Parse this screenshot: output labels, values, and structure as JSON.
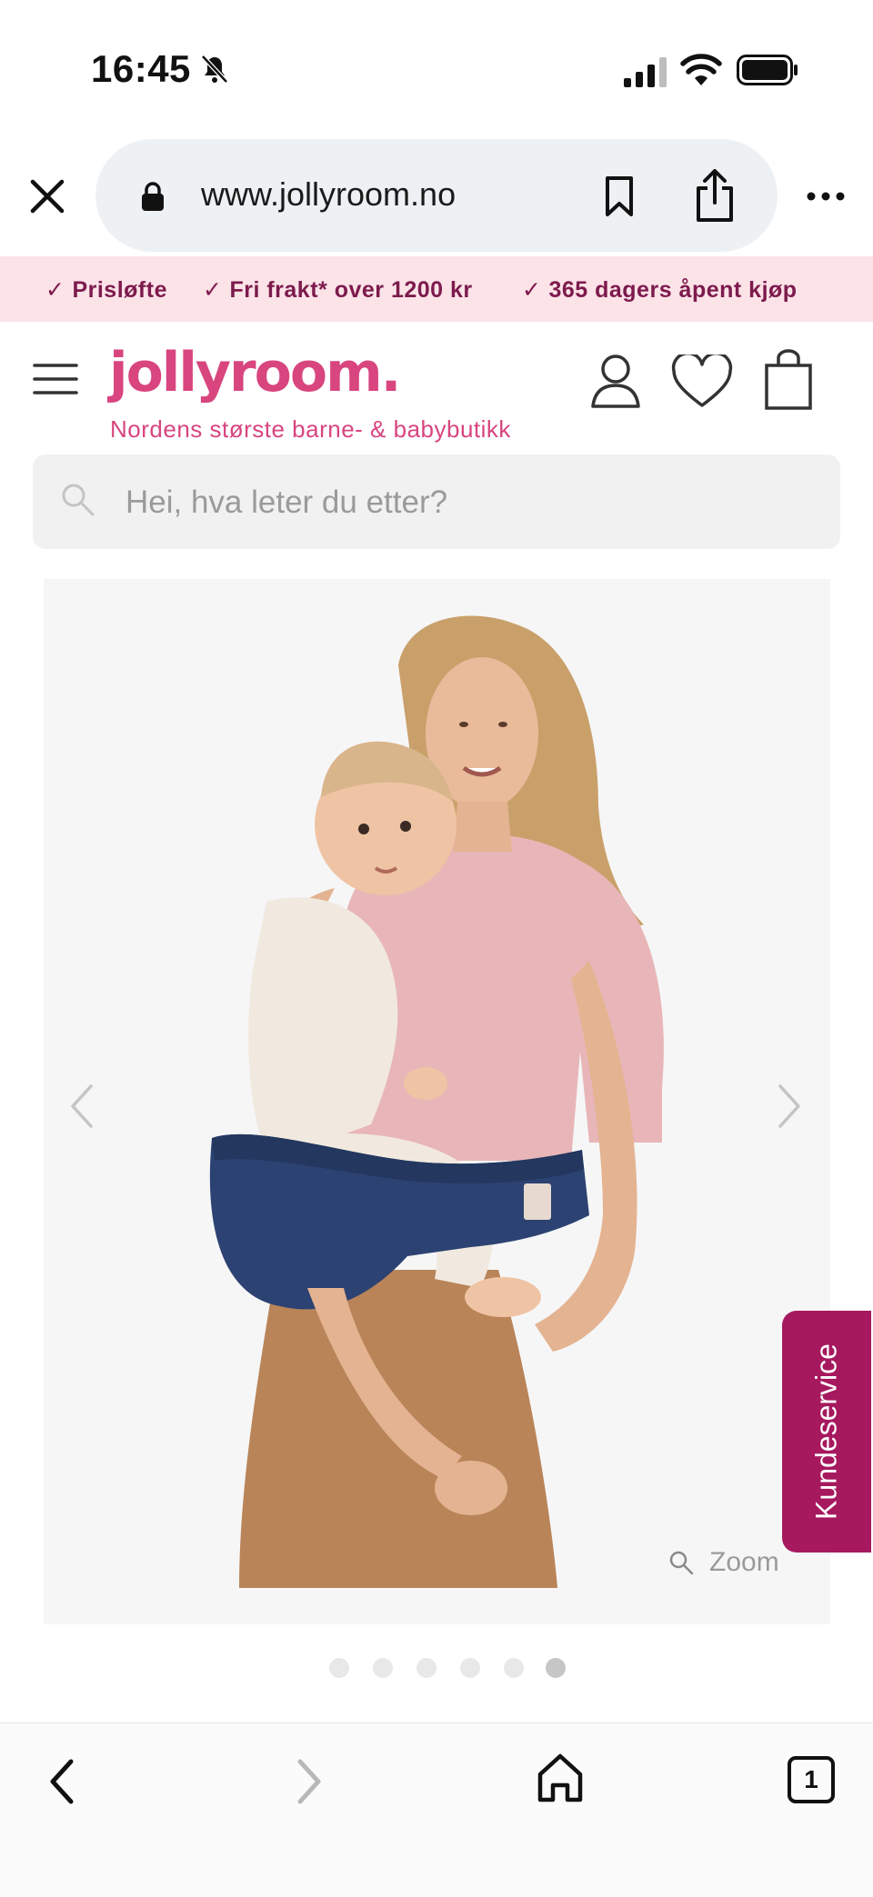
{
  "status_bar": {
    "time": "16:45",
    "icons": [
      "bell-slash-icon",
      "signal-icon",
      "wifi-icon",
      "battery-icon"
    ]
  },
  "browser": {
    "url": "www.jollyroom.no",
    "icons": [
      "close-icon",
      "lock-icon",
      "bookmark-icon",
      "share-icon",
      "more-icon"
    ]
  },
  "promo_bar": {
    "items": [
      "Prisløfte",
      "Fri frakt* over 1200 kr",
      "365 dagers åpent kjøp"
    ]
  },
  "header": {
    "logo": "jollyroom.",
    "tagline": "Nordens største barne- & babybutikk",
    "icons": [
      "menu-icon",
      "account-icon",
      "heart-icon",
      "shopping-bag-icon"
    ]
  },
  "search": {
    "placeholder": "Hei, hva leter du etter?"
  },
  "product_gallery": {
    "zoom_label": "Zoom",
    "image_count": 6,
    "active_index": 5
  },
  "side_tab": {
    "label": "Kundeservice"
  },
  "bottom_toolbar": {
    "tab_count": "1",
    "icons": [
      "back-icon",
      "forward-icon",
      "home-icon",
      "tabs-icon"
    ]
  },
  "colors": {
    "brand_pink": "#d8457f",
    "promo_bg": "#fbe3e8",
    "promo_text": "#7d1a4d",
    "kundeservice_bg": "#a6195e"
  }
}
